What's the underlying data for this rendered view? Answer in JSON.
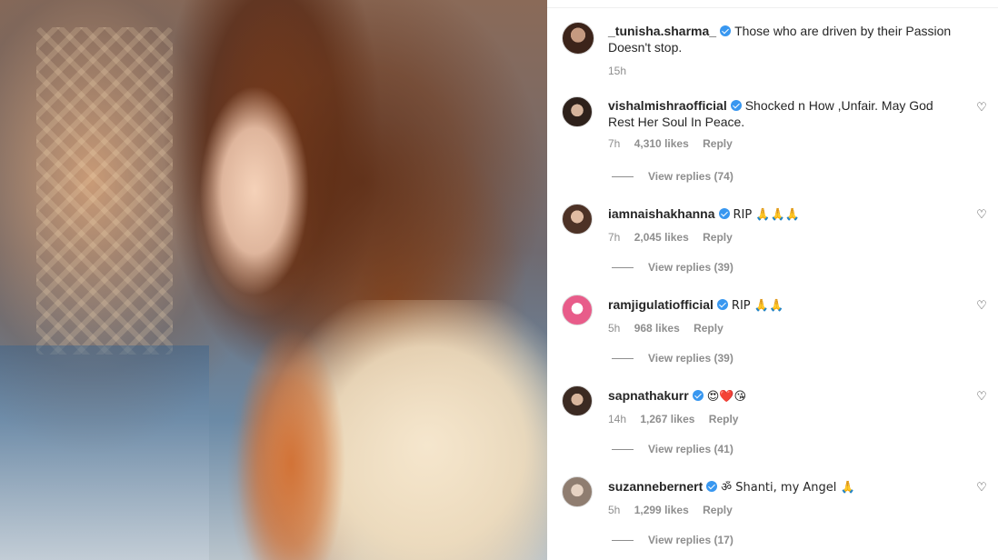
{
  "post": {
    "author": "_tunisha.sharma_",
    "caption": "Those who are driven by their Passion Doesn't stop.",
    "time": "15h"
  },
  "comments": [
    {
      "username": "vishalmishraofficial",
      "text": "Shocked n How ,Unfair. May God Rest Her Soul In Peace.",
      "time": "7h",
      "likes": "4,310 likes",
      "reply": "Reply",
      "view_replies": "View replies (74)",
      "avatar_color": "#3a2a22"
    },
    {
      "username": "iamnaishakhanna",
      "text": "RIP 🙏🙏🙏",
      "time": "7h",
      "likes": "2,045 likes",
      "reply": "Reply",
      "view_replies": "View replies (39)",
      "avatar_color": "#5a3a2c"
    },
    {
      "username": "ramjigulatiofficial",
      "text": "RIP 🙏🙏",
      "time": "5h",
      "likes": "968 likes",
      "reply": "Reply",
      "view_replies": "View replies (39)",
      "avatar_color": "#e85c8a"
    },
    {
      "username": "sapnathakurr",
      "text": "😍❤️😘",
      "time": "14h",
      "likes": "1,267 likes",
      "reply": "Reply",
      "view_replies": "View replies (41)",
      "avatar_color": "#4a3428"
    },
    {
      "username": "suzannebernert",
      "text": "ॐ Shanti, my Angel 🙏",
      "time": "5h",
      "likes": "1,299 likes",
      "reply": "Reply",
      "view_replies": "View replies (17)",
      "avatar_color": "#b8a89a"
    }
  ],
  "icons": {
    "heart": "heart-outline-icon",
    "verified": "verified-badge-icon"
  },
  "colors": {
    "verified": "#3897f0",
    "meta_text": "#8e8e8e",
    "primary_text": "#262626"
  }
}
